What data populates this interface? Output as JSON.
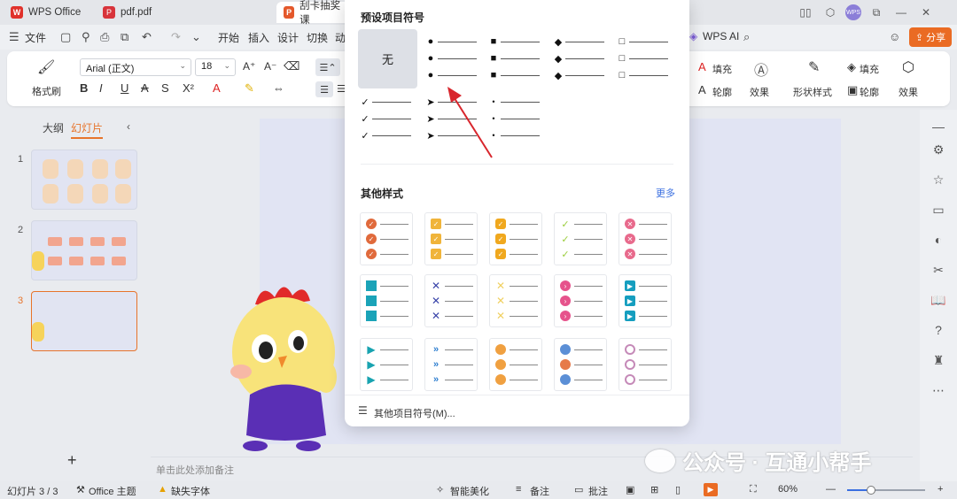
{
  "titlebar": {
    "tabs": [
      {
        "label": "WPS Office",
        "icon": "wps-logo-icon"
      },
      {
        "label": "pdf.pdf",
        "icon": "pdf-icon"
      },
      {
        "label": "刮卡抽奖课",
        "icon": "ppt-icon"
      }
    ],
    "avatar_text": "WPS"
  },
  "menubar": {
    "file_label": "文件",
    "items": [
      "开始",
      "插入",
      "设计",
      "切换",
      "动"
    ],
    "wps_ai_label": "WPS AI",
    "share_label": "分享"
  },
  "ribbon": {
    "format_painter_label": "格式刷",
    "font_name": "Arial (正文)",
    "font_size": "18",
    "fill_label": "填充",
    "outline_label": "轮廓",
    "effect_label": "效果",
    "shape_style_label": "形状样式",
    "fill2_label": "填充",
    "outline2_label": "轮廓",
    "effect2_label": "效果"
  },
  "leftpanel": {
    "tab_outline": "大纲",
    "tab_slides": "幻灯片",
    "slides": [
      {
        "number": "1"
      },
      {
        "number": "2"
      },
      {
        "number": "3"
      }
    ],
    "add_label": "+"
  },
  "canvas": {
    "notes_placeholder": "单击此处添加备注"
  },
  "bullet_dropdown": {
    "title": "预设项目符号",
    "none_label": "无",
    "other_styles_label": "其他样式",
    "more_label": "更多",
    "footer_label": "其他项目符号(M)..."
  },
  "statusbar": {
    "slide_count": "幻灯片 3 / 3",
    "theme": "Office 主题",
    "missing_font": "缺失字体",
    "beautify": "智能美化",
    "notes": "备注",
    "comments": "批注",
    "zoom": "60%"
  },
  "watermark": {
    "text": "公众号 · 互通小帮手"
  },
  "colors": {
    "accent": "#ea6b23",
    "link": "#3a6fe0",
    "slide_bg": "#e1e4f3"
  }
}
